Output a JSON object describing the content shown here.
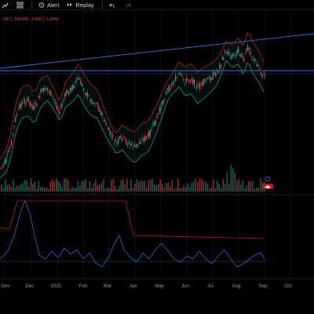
{
  "toolbar": {
    "alert_label": "Alert",
    "replay_label": "Replay"
  },
  "ohlc": {
    "text": ".742  C 109,606  −2,930 (−1.33%)"
  },
  "xaxis": {
    "labels": [
      "Nov",
      "Dec",
      "2025",
      "Feb",
      "Mar",
      "Apr",
      "May",
      "Jun",
      "Jul",
      "Aug",
      "Sep",
      "Oct"
    ]
  },
  "colors": {
    "background": "#000000",
    "candle_up": "#26a69a",
    "candle_down": "#ef5350",
    "band_upper": "#c62828",
    "band_lower": "#26a69a",
    "trendline": "#3f6fd8",
    "oscillator_line": "#3f5fd1",
    "oscillator_level": "#b71c1c"
  },
  "badges": {
    "arrows": "◀▶"
  }
}
